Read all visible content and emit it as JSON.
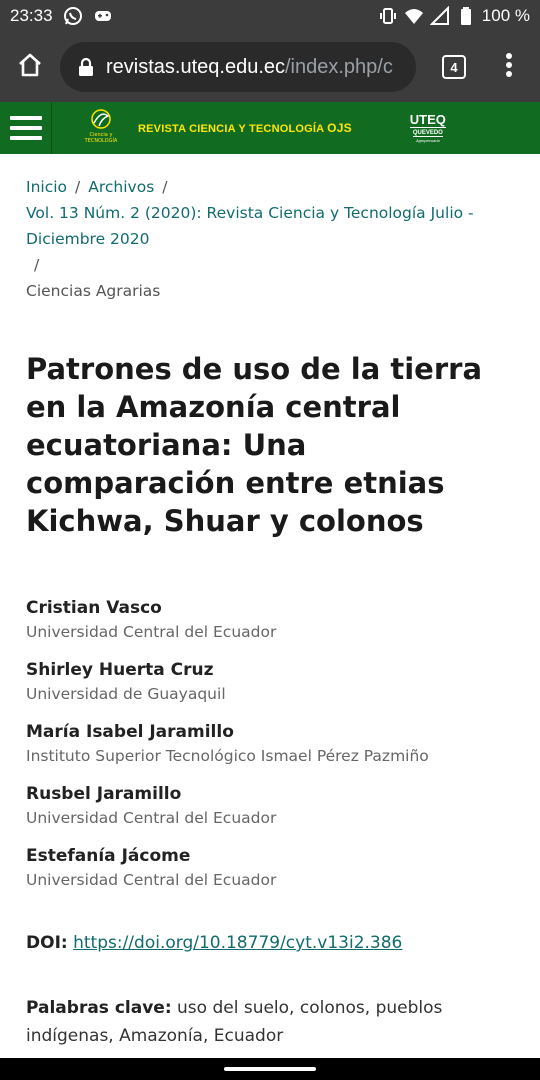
{
  "status_bar": {
    "time": "23:33",
    "battery": "100 %",
    "icons": [
      "whatsapp-icon",
      "game-controller-icon",
      "vibrate-icon",
      "wifi-icon",
      "signal-icon",
      "battery-icon"
    ]
  },
  "browser": {
    "url_host": "revistas.uteq.edu.ec",
    "url_path": "/index.php/c",
    "tab_count": "4",
    "icons": [
      "home-icon",
      "lock-icon",
      "more-vert-icon"
    ]
  },
  "site_header": {
    "logo_sub": "Ciencia y TECNOLOGÍA",
    "brand_text": "REVISTA CIENCIA Y TECNOLOGÍA ",
    "brand_ojs": "OJS",
    "uteq_main": "UTEQ",
    "uteq_sub": "QUEVEDO",
    "uteq_tag": "Agropecuaria"
  },
  "breadcrumb": {
    "home": "Inicio",
    "archives": "Archivos",
    "issue": "Vol. 13 Núm. 2 (2020): Revista Ciencia y Tecnología Julio - Diciembre 2020",
    "separator": "/",
    "current": "Ciencias Agrarias"
  },
  "article": {
    "title": "Patrones de uso de la tierra en la Amazonía central ecuatoriana: Una comparación entre etnias Kichwa, Shuar y colonos",
    "authors": [
      {
        "name": "Cristian Vasco",
        "affiliation": "Universidad Central del Ecuador"
      },
      {
        "name": "Shirley Huerta Cruz",
        "affiliation": "Universidad de Guayaquil"
      },
      {
        "name": "María Isabel Jaramillo",
        "affiliation": "Instituto Superior Tecnológico Ismael Pérez Pazmiño"
      },
      {
        "name": "Rusbel Jaramillo",
        "affiliation": "Universidad Central del Ecuador"
      },
      {
        "name": "Estefanía Jácome",
        "affiliation": "Universidad Central del Ecuador"
      }
    ],
    "doi_label": "DOI:",
    "doi_link": "https://doi.org/10.18779/cyt.v13i2.386",
    "keywords_label": "Palabras clave:",
    "keywords": "uso del suelo, colonos, pueblos indígenas, Amazonía, Ecuador"
  },
  "colors": {
    "header_green": "#116b21",
    "brand_yellow": "#ffe600",
    "link_teal": "#116b6f",
    "chrome_dark": "#3c3c3c"
  }
}
